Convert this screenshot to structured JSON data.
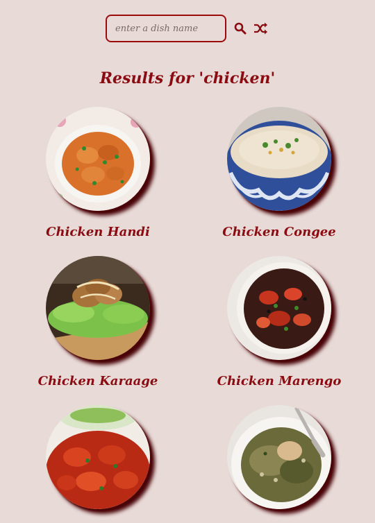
{
  "search": {
    "placeholder": "enter a dish name",
    "search_icon": "search-icon",
    "shuffle_icon": "shuffle-icon"
  },
  "results": {
    "title": "Results for 'chicken'"
  },
  "recipes": [
    {
      "title": "Chicken Handi",
      "image": "plated chicken curry"
    },
    {
      "title": "Chicken Congee",
      "image": "congee in blue patterned bowl"
    },
    {
      "title": "Chicken Karaage",
      "image": "fried chicken on lettuce"
    },
    {
      "title": "Chicken Marengo",
      "image": "chicken with shrimp in skillet"
    },
    {
      "title": "",
      "image": "tandoori chicken pieces"
    },
    {
      "title": "",
      "image": "chicken on grain salad"
    }
  ],
  "colors": {
    "background": "#e8dad7",
    "accent": "#8a0c12",
    "shadow": "#4a0509"
  }
}
